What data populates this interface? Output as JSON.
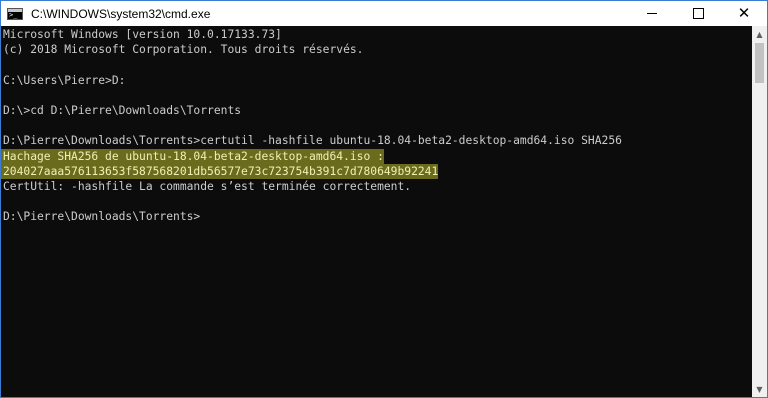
{
  "window": {
    "title": "C:\\WINDOWS\\system32\\cmd.exe",
    "controls": {
      "minimize": "—",
      "maximize": "□",
      "close": "✕"
    }
  },
  "console": {
    "lines": [
      "Microsoft Windows [version 10.0.17133.73]",
      "(c) 2018 Microsoft Corporation. Tous droits réservés.",
      "",
      "C:\\Users\\Pierre>D:",
      "",
      "D:\\>cd D:\\Pierre\\Downloads\\Torrents",
      "",
      "D:\\Pierre\\Downloads\\Torrents>certutil -hashfile ubuntu-18.04-beta2-desktop-amd64.iso SHA256",
      "Hachage SHA256 de ubuntu-18.04-beta2-desktop-amd64.iso :",
      "204027aaa576113653f587568201db56577e73c723754b391c7d780649b92241",
      "CertUtil: -hashfile La commande s’est terminée correctement.",
      "",
      "D:\\Pierre\\Downloads\\Torrents>"
    ],
    "highlighted_lines": [
      8,
      9
    ],
    "highlight_color": "#6b6b1e"
  },
  "icons": {
    "app": "cmd-console-icon",
    "scroll_up": "▲",
    "scroll_down": "▼"
  }
}
